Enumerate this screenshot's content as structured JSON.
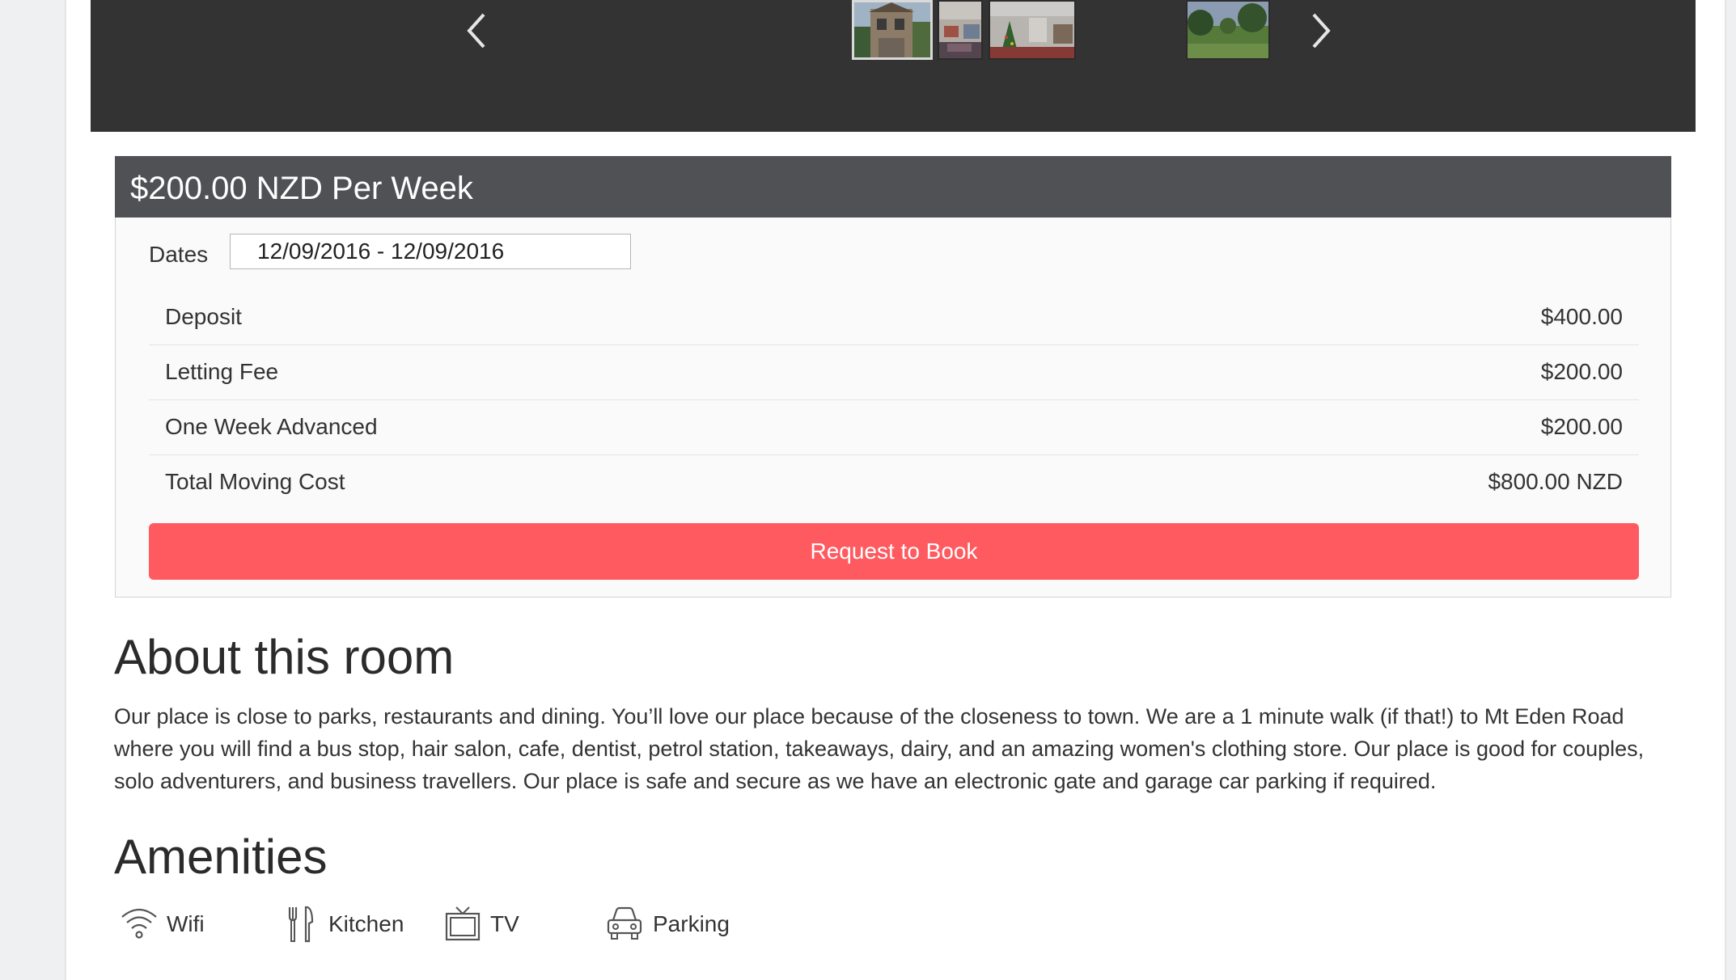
{
  "gallery": {
    "prev_icon": "chevron-left-icon",
    "next_icon": "chevron-right-icon",
    "thumbnails": [
      {
        "alt": "House exterior",
        "active": true
      },
      {
        "alt": "Living room",
        "active": false
      },
      {
        "alt": "Interior with christmas tree",
        "active": false
      },
      {
        "alt": "Garden",
        "active": false
      }
    ]
  },
  "pricing": {
    "title": "$200.00 NZD Per Week"
  },
  "booking": {
    "dates_label": "Dates",
    "dates_value": "12/09/2016 - 12/09/2016",
    "rows": [
      {
        "label": "Deposit",
        "value": "$400.00"
      },
      {
        "label": "Letting Fee",
        "value": "$200.00"
      },
      {
        "label": "One Week Advanced",
        "value": "$200.00"
      },
      {
        "label": "Total Moving Cost",
        "value": "$800.00 NZD"
      }
    ],
    "button_label": "Request to Book",
    "button_color": "#ff5a5f"
  },
  "about": {
    "title": "About this room",
    "text": "Our place is close to parks, restaurants and dining. You’ll love our place because of the closeness to town. We are a 1 minute walk (if that!) to Mt Eden Road where you will find a bus stop, hair salon, cafe, dentist, petrol station, takeaways, dairy, and an amazing women's clothing store. Our place is good for couples, solo adventurers, and business travellers. Our place is safe and secure as we have an electronic gate and garage car parking if required."
  },
  "amenities": {
    "title": "Amenities",
    "items": [
      {
        "label": "Wifi",
        "icon": "wifi-icon"
      },
      {
        "label": "Kitchen",
        "icon": "kitchen-icon"
      },
      {
        "label": "TV",
        "icon": "tv-icon"
      },
      {
        "label": "Parking",
        "icon": "car-icon"
      }
    ]
  }
}
